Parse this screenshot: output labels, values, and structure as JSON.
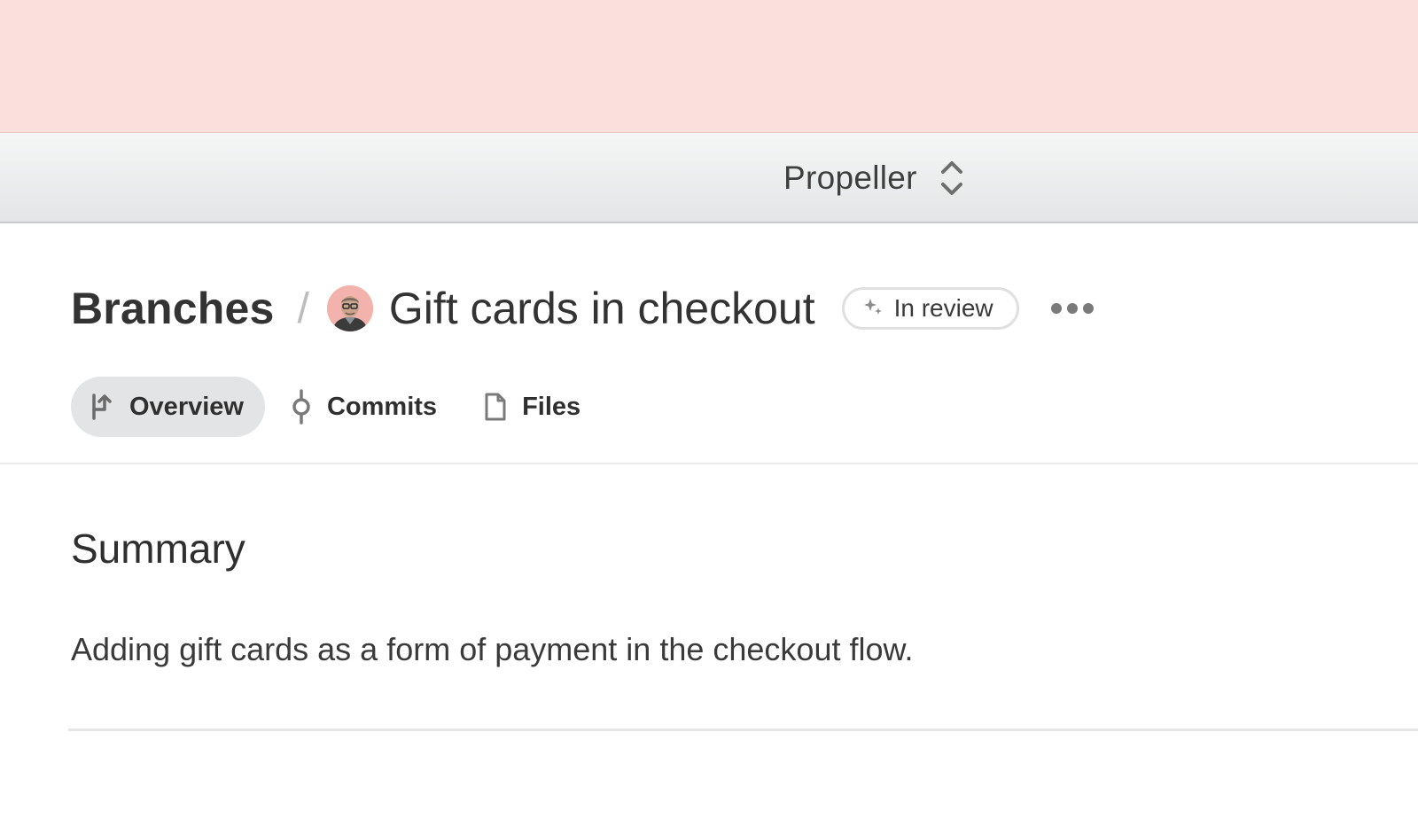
{
  "title_bar": {
    "project_name": "Propeller",
    "switcher_icon": "chevron-up-down-icon"
  },
  "header": {
    "breadcrumb_root": "Branches",
    "breadcrumb_separator": "/",
    "branch_title": "Gift cards in checkout",
    "status": {
      "label": "In review",
      "icon": "sparkle-icon"
    },
    "more_icon": "ellipsis-icon"
  },
  "tabs": [
    {
      "label": "Overview",
      "icon": "branch-merge-icon",
      "active": true
    },
    {
      "label": "Commits",
      "icon": "commit-icon",
      "active": false
    },
    {
      "label": "Files",
      "icon": "file-icon",
      "active": false
    }
  ],
  "summary": {
    "heading": "Summary",
    "text": "Adding gift cards as a form of payment in the checkout flow."
  },
  "colors": {
    "top_band": "#fbdfdc",
    "active_tab_bg": "#e3e4e5",
    "text": "#333333"
  }
}
